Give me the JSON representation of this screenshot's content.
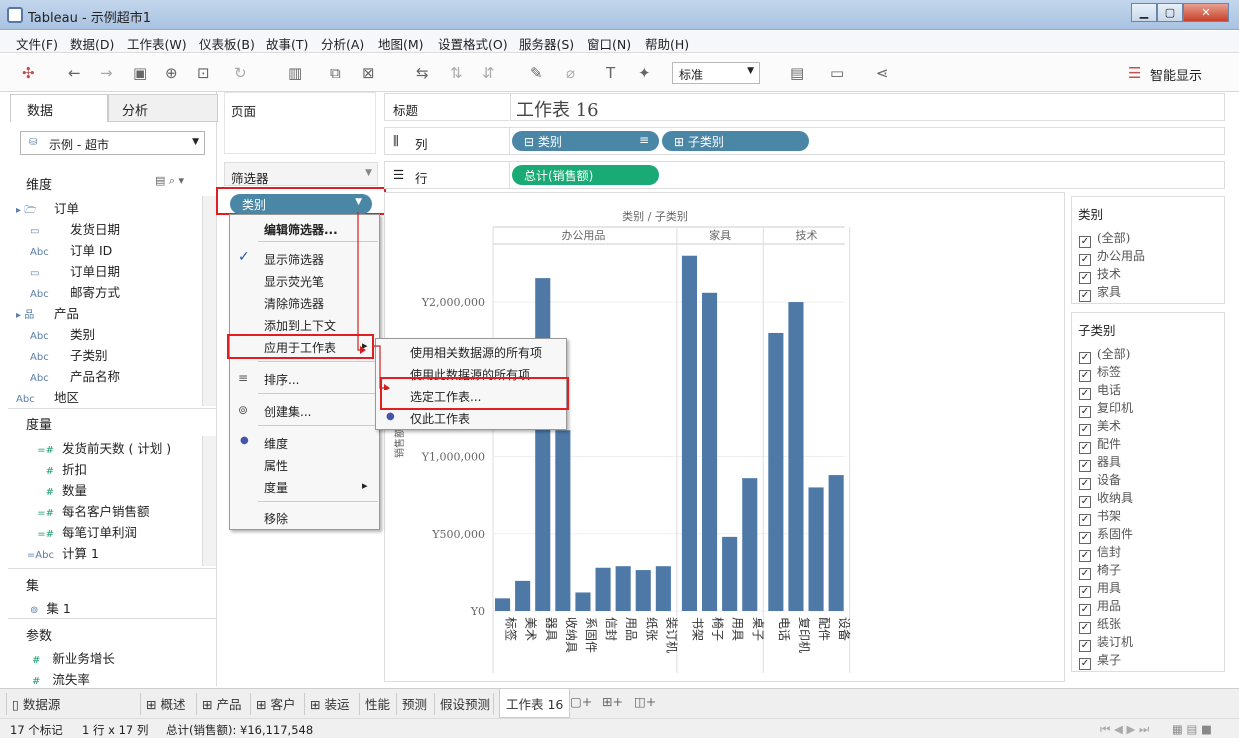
{
  "window": {
    "title": "Tableau - 示例超市1"
  },
  "menu": [
    "文件(F)",
    "数据(D)",
    "工作表(W)",
    "仪表板(B)",
    "故事(T)",
    "分析(A)",
    "地图(M)",
    "设置格式(O)",
    "服务器(S)",
    "窗口(N)",
    "帮助(H)"
  ],
  "toolbar": {
    "fit": "标准",
    "show_me": "智能显示"
  },
  "left": {
    "tab_data": "数据",
    "tab_analytics": "分析",
    "datasource": "示例 - 超市",
    "dimensions_title": "维度",
    "dimensions": [
      {
        "label": "订单",
        "icon": "folder",
        "indent": 1
      },
      {
        "label": "发货日期",
        "icon": "date",
        "indent": 2
      },
      {
        "label": "订单 ID",
        "icon": "Abc",
        "indent": 2
      },
      {
        "label": "订单日期",
        "icon": "date",
        "indent": 2
      },
      {
        "label": "邮寄方式",
        "icon": "Abc",
        "indent": 2
      },
      {
        "label": "产品",
        "icon": "hier",
        "indent": 1
      },
      {
        "label": "类别",
        "icon": "Abc",
        "indent": 2
      },
      {
        "label": "子类别",
        "icon": "Abc",
        "indent": 2
      },
      {
        "label": "产品名称",
        "icon": "Abc",
        "indent": 2
      },
      {
        "label": "地区",
        "icon": "Abc",
        "indent": 1
      }
    ],
    "measures_title": "度量",
    "measures": [
      {
        "label": "发货前天数 ( 计划 )",
        "icon": "=#"
      },
      {
        "label": "折扣",
        "icon": "#"
      },
      {
        "label": "数量",
        "icon": "#"
      },
      {
        "label": "每名客户销售额",
        "icon": "=#"
      },
      {
        "label": "每笔订单利润",
        "icon": "=#"
      },
      {
        "label": "计算 1",
        "icon": "=Abc"
      }
    ],
    "sets_title": "集",
    "sets": [
      "集 1"
    ],
    "params_title": "参数",
    "params": [
      "新业务增长",
      "流失率"
    ]
  },
  "shelves": {
    "pages": "页面",
    "filters": "筛选器",
    "filter_pill": "类别",
    "marks_title": "标题",
    "columns": "列",
    "rows": "行",
    "col_pills": [
      "类别",
      "子类别"
    ],
    "row_pill": "总计(销售额)",
    "sheet_title": "工作表 16"
  },
  "context_menu": {
    "items": [
      {
        "label": "编辑筛选器...",
        "bold": true
      },
      {
        "label": "显示筛选器",
        "checked": true
      },
      {
        "label": "显示荧光笔"
      },
      {
        "label": "清除筛选器"
      },
      {
        "label": "添加到上下文"
      },
      {
        "label": "应用于工作表",
        "submenu": true,
        "highlight": true
      },
      {
        "label": "排序..."
      },
      {
        "label": "创建集..."
      },
      {
        "label": "维度",
        "radio": true
      },
      {
        "label": "属性"
      },
      {
        "label": "度量",
        "submenu": true
      },
      {
        "label": "移除"
      }
    ],
    "submenu": [
      {
        "label": "使用相关数据源的所有项"
      },
      {
        "label": "使用此数据源的所有项"
      },
      {
        "label": "选定工作表...",
        "highlight": true
      },
      {
        "label": "仅此工作表",
        "radio": true
      }
    ]
  },
  "chart_data": {
    "type": "bar",
    "title": "",
    "header": "类别  /  子类别",
    "groups": [
      {
        "name": "办公用品",
        "categories": [
          "标签",
          "美术",
          "器具",
          "收纳具",
          "系固件",
          "信封",
          "用品",
          "纸张",
          "装订机"
        ],
        "values": [
          82000,
          195000,
          2155000,
          1170000,
          120000,
          280000,
          290000,
          265000,
          290000
        ]
      },
      {
        "name": "家具",
        "categories": [
          "书架",
          "椅子",
          "用具",
          "桌子"
        ],
        "values": [
          2300000,
          2060000,
          480000,
          860000
        ]
      },
      {
        "name": "技术",
        "categories": [
          "电话",
          "复印机",
          "配件",
          "设备"
        ],
        "values": [
          1800000,
          2000000,
          800000,
          880000
        ]
      }
    ],
    "ylabel": "销售额",
    "yticks": [
      "Y0",
      "Y500,000",
      "Y1,000,000",
      "Y2,000,000"
    ],
    "ylim": [
      0,
      2350000
    ]
  },
  "right": {
    "cat_title": "类别",
    "cat_items": [
      "(全部)",
      "办公用品",
      "技术",
      "家具"
    ],
    "sub_title": "子类别",
    "sub_items": [
      "(全部)",
      "标签",
      "电话",
      "复印机",
      "美术",
      "配件",
      "器具",
      "设备",
      "收纳具",
      "书架",
      "系固件",
      "信封",
      "椅子",
      "用具",
      "用品",
      "纸张",
      "装订机",
      "桌子"
    ]
  },
  "bottom_tabs": [
    "数据源",
    "概述",
    "产品",
    "客户",
    "装运",
    "性能",
    "预测",
    "假设预测",
    "工作表 16"
  ],
  "status": {
    "marks": "17 个标记",
    "dims": "1 行 x 17 列",
    "sum": "总计(销售额): ¥16,117,548"
  }
}
